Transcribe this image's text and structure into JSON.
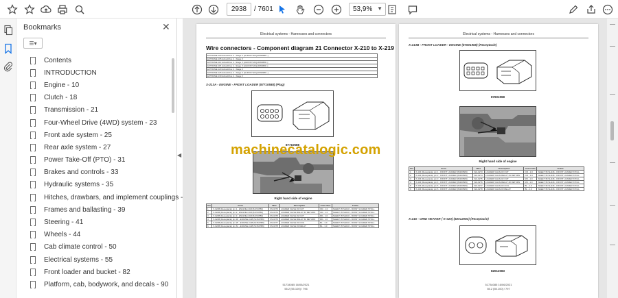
{
  "toolbar": {
    "page_current": "2938",
    "page_total": "/ 7601",
    "zoom": "53,9%"
  },
  "bookmarks_panel": {
    "title": "Bookmarks",
    "items": [
      "Contents",
      "INTRODUCTION",
      "Engine - 10",
      "Clutch - 18",
      "Transmission - 21",
      "Four-Wheel Drive (4WD) system - 23",
      "Front axle system - 25",
      "Rear axle system - 27",
      "Power Take-Off (PTO) - 31",
      "Brakes and controls - 33",
      "Hydraulic systems - 35",
      "Hitches, drawbars, and implement couplings - 37",
      "Frames and ballasting - 39",
      "Steering - 41",
      "Wheels - 44",
      "Cab climate control - 50",
      "Electrical systems - 55",
      "Front loader and bucket - 82",
      "Platform, cab, bodywork, and decals - 90"
    ]
  },
  "watermark": "machinecatalogic.com",
  "page_left": {
    "header": "Electrical systems - Harnesses and connectors",
    "title": "Wire connectors - Component diagram 21 Connector X-210 to X-219",
    "model_rows": [
      "EXTRUME 100 ActiveDrive 4 - Stage V [HLRUFYGKQLDW####.-]",
      "EXTRUME 105 ActiveDrive 4 - Stage V",
      "EXTRUME 110 ActiveDrive 4 - Stage V [HLRUFYGKQLDW####.-]",
      "EXTRUME 115 ActiveDrive 4 - Stage V [HLRUFYGKQLDW####.-]",
      "EXTRUME 120 ActiveDrive 4 - Stage V",
      "EXTRUME 125 ActiveDrive 4 - Stage V [HLRUFYGKQLDW####.-]",
      "EXTRUME 130 ActiveDrive 4 - Stage V"
    ],
    "connector_caption": "X-213A - ENGINE - FRONT LOADER (87710588) (Plug)",
    "part_number": "87710588",
    "photo_caption": "Right hand side of engine",
    "table_headers": [
      "Pin",
      "From",
      "Wire",
      "Description",
      "Color Size",
      "Frame"
    ],
    "table_rows": [
      [
        "1",
        "X-024B (Receptacle) pin 1 - ENGINE-CAB (5c1547B6)",
        "FN-0273",
        "LOADER VALVE #3 OUT",
        "OR - 1.0",
        "SHEET 35 SH146 - FRONT LOADER STOLL"
      ],
      [
        "2",
        "X-024B (Receptacle) pin 2 - ENGINE-CAB (5c1547B6)",
        "FN-0274",
        "LOADER VALVE RELAY #1 RETURN",
        "OR - 1.0",
        "SHEET 35 SH146 - FRONT LOADER STOLL"
      ],
      [
        "3",
        "X-024B (Receptacle) pin 3 - ENGINE-CAB (5c1547B6)",
        "FN-0275",
        "LOADER VALVE #2 OUT",
        "RD - 1.0",
        "SHEET 35 SH146 - FRONT LOADER STOLL"
      ],
      [
        "4",
        "X-024B (Receptacle) pin 18 - ENGINE-CAB (5c1547B6)",
        "FN-0276",
        "LOADER VALVE RELAY #2 RETURN",
        "RD - 1.0",
        "SHEET 35 SH146 - FRONT LOADER STOLL"
      ],
      [
        "5",
        "X-024B (Receptacle) pin 25 - ENGINE-CAB (5c1547B6)",
        "FN-0277",
        "LOADER VALVE #3 COIL",
        "BL - 1.0",
        "SHEET 35 SH146 - FRONT LOADER STOLL"
      ],
      [
        "6",
        "X-024B (Receptacle) pin 61 - ENGINE-CAB (5c1547B6)",
        "FN-0278",
        "LOADER VALVE #3 RELAY",
        "BL - 1.0",
        "SHEET 35 SH146 - FRONT LOADER STOLL"
      ]
    ],
    "footer_line1": "51734085 16/06/2021",
    "footer_line2": "55.2 [55.100] / 796"
  },
  "page_right": {
    "header": "Electrical systems - Harnesses and connectors",
    "connector_caption": "X-213B - FRONT LOADER - ENGINE (87601968) (Receptacle)",
    "part_number": "87601968",
    "photo_caption": "Right hand side of engine",
    "table_headers": [
      "Pin",
      "From",
      "Wire",
      "Description",
      "Color Size",
      "Frame"
    ],
    "table_rows": [
      [
        "1",
        "X-404 (Receptacle) pin 1 - FRONT LOADER (84160584)",
        "FL0-0273",
        "LOADER VALVE #3 OUT",
        "OR - 1.0",
        "SHEET 35 SH146 - FRONT LOADER STOLL"
      ],
      [
        "2",
        "X-404 (Receptacle) pin 2 - FRONT LOADER (84160584)",
        "FL0-0274",
        "LOADER VALVE RELAY #1 RETURN",
        "OR - 1.0",
        "SHEET 35 SH146 - FRONT LOADER STOLL"
      ],
      [
        "3",
        "X-404 (Receptacle) pin 3 - FRONT LOADER (84160584)",
        "FL0-0275",
        "LOADER VALVE #2 OUT",
        "RD - 1.0",
        "SHEET 35 SH146 - FRONT LOADER STOLL"
      ],
      [
        "4",
        "X-404 (Receptacle) pin 4 - FRONT LOADER (84160584)",
        "FL0-0276",
        "LOADER VALVE RELAY #2 RETURN",
        "RD - 1.0",
        "SHEET 35 SH146 - FRONT LOADER STOLL"
      ],
      [
        "5",
        "X-404 (Receptacle) pin 5 - FRONT LOADER (84160584)",
        "FL0-0277",
        "LOADER VALVE #3 COIL",
        "BL - 1.0",
        "SHEET 35 SH146 - FRONT LOADER STOLL"
      ],
      [
        "6",
        "X-404 (Receptacle) pin 6 - FRONT LOADER (84160584)",
        "FL0-0278",
        "LOADER VALVE #3 RELAY",
        "BL - 1.0",
        "SHEET 35 SH146 - FRONT LOADER STOLL"
      ]
    ],
    "connector2_caption": "X-215 - GRID HEATER ( K-023) (82012083) (Receptacle)",
    "part_number2": "82012083",
    "footer_line1": "51734085 16/06/2021",
    "footer_line2": "55.2 [55.100] / 797"
  }
}
